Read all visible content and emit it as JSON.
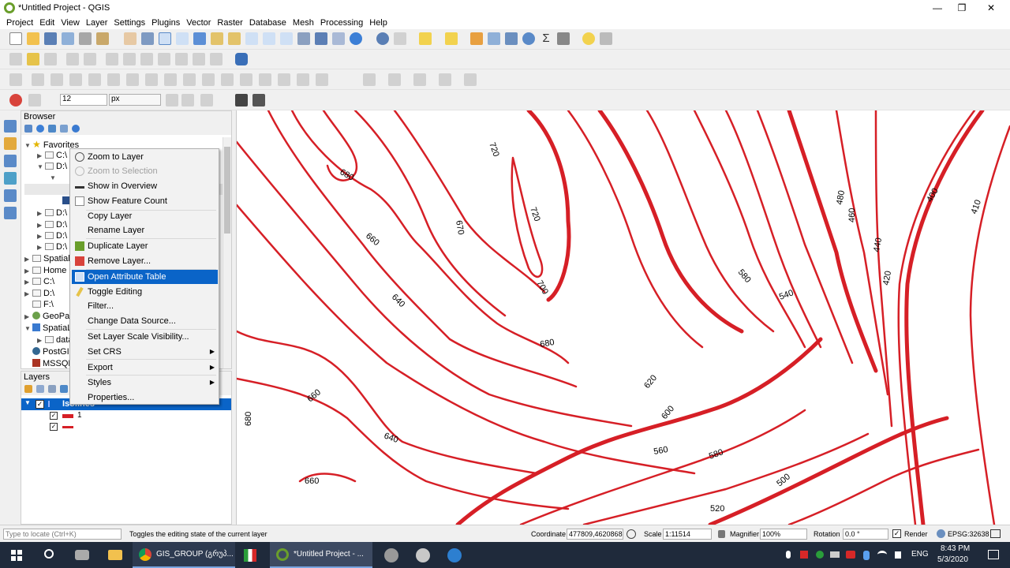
{
  "window": {
    "title": "*Untitled Project - QGIS",
    "minimize": "—",
    "restore": "❐",
    "close": "✕"
  },
  "menu": [
    "Project",
    "Edit",
    "View",
    "Layer",
    "Settings",
    "Plugins",
    "Vector",
    "Raster",
    "Database",
    "Mesh",
    "Processing",
    "Help"
  ],
  "digitize_toolbar": {
    "size_value": "12",
    "unit_value": "px"
  },
  "browser": {
    "title": "Browser",
    "items": [
      {
        "label": "Favorites",
        "indent": 0
      },
      {
        "label": "C:\\",
        "indent": 1
      },
      {
        "label": "D:\\",
        "indent": 1
      },
      {
        "label": "D:\\",
        "indent": 1
      },
      {
        "label": "D:\\",
        "indent": 1
      },
      {
        "label": "D:\\",
        "indent": 1
      },
      {
        "label": "D:\\",
        "indent": 1
      },
      {
        "label": "Spatial Bookmarks",
        "indent": 0
      },
      {
        "label": "Home",
        "indent": 0
      },
      {
        "label": "C:\\",
        "indent": 0
      },
      {
        "label": "D:\\",
        "indent": 0
      },
      {
        "label": "F:\\",
        "indent": 0
      },
      {
        "label": "GeoPackage",
        "indent": 0
      },
      {
        "label": "SpatiaLite",
        "indent": 0
      },
      {
        "label": "data.sqlite",
        "indent": 1
      },
      {
        "label": "PostGIS",
        "indent": 0
      },
      {
        "label": "MSSQL",
        "indent": 0
      }
    ]
  },
  "layers": {
    "title": "Layers",
    "layer_name": "Isolines",
    "legend": [
      "1",
      ""
    ]
  },
  "context_menu": {
    "items": [
      {
        "label": "Zoom to Layer",
        "disabled": false
      },
      {
        "label": "Zoom to Selection",
        "disabled": true
      },
      {
        "label": "Show in Overview",
        "disabled": false
      },
      {
        "label": "Show Feature Count",
        "disabled": false
      },
      {
        "label": "Copy Layer",
        "disabled": false
      },
      {
        "label": "Rename Layer",
        "disabled": false
      },
      {
        "label": "Duplicate Layer",
        "disabled": false
      },
      {
        "label": "Remove Layer...",
        "disabled": false
      },
      {
        "label": "Open Attribute Table",
        "disabled": false,
        "highlighted": true
      },
      {
        "label": "Toggle Editing",
        "disabled": false
      },
      {
        "label": "Filter...",
        "disabled": false
      },
      {
        "label": "Change Data Source...",
        "disabled": false
      },
      {
        "label": "Set Layer Scale Visibility...",
        "disabled": false
      },
      {
        "label": "Set CRS",
        "disabled": false,
        "submenu": true
      },
      {
        "label": "Export",
        "disabled": false,
        "submenu": true
      },
      {
        "label": "Styles",
        "disabled": false,
        "submenu": true
      },
      {
        "label": "Properties...",
        "disabled": false
      }
    ]
  },
  "map": {
    "line_color": "#d61f26",
    "contour_labels": [
      "720",
      "680",
      "720",
      "670",
      "660",
      "700",
      "640",
      "680",
      "480",
      "460",
      "440",
      "420",
      "400",
      "410",
      "580",
      "540",
      "620",
      "600",
      "560",
      "580",
      "500",
      "520",
      "660",
      "640",
      "660",
      "680"
    ]
  },
  "statusbar": {
    "locate_placeholder": "Type to locate (Ctrl+K)",
    "message": "Toggles the editing state of the current layer",
    "coordinate_label": "Coordinate",
    "coordinate_value": "477809,4620868",
    "scale_label": "Scale",
    "scale_value": "1:11514",
    "magnifier_label": "Magnifier",
    "magnifier_value": "100%",
    "rotation_label": "Rotation",
    "rotation_value": "0.0 °",
    "render_label": "Render",
    "crs": "EPSG:32638"
  },
  "taskbar": {
    "chrome_label": "GIS_GROUP (გრუპ...",
    "qgis_label": "*Untitled Project - ...",
    "lang": "ENG",
    "time": "8:43 PM",
    "date": "5/3/2020"
  }
}
